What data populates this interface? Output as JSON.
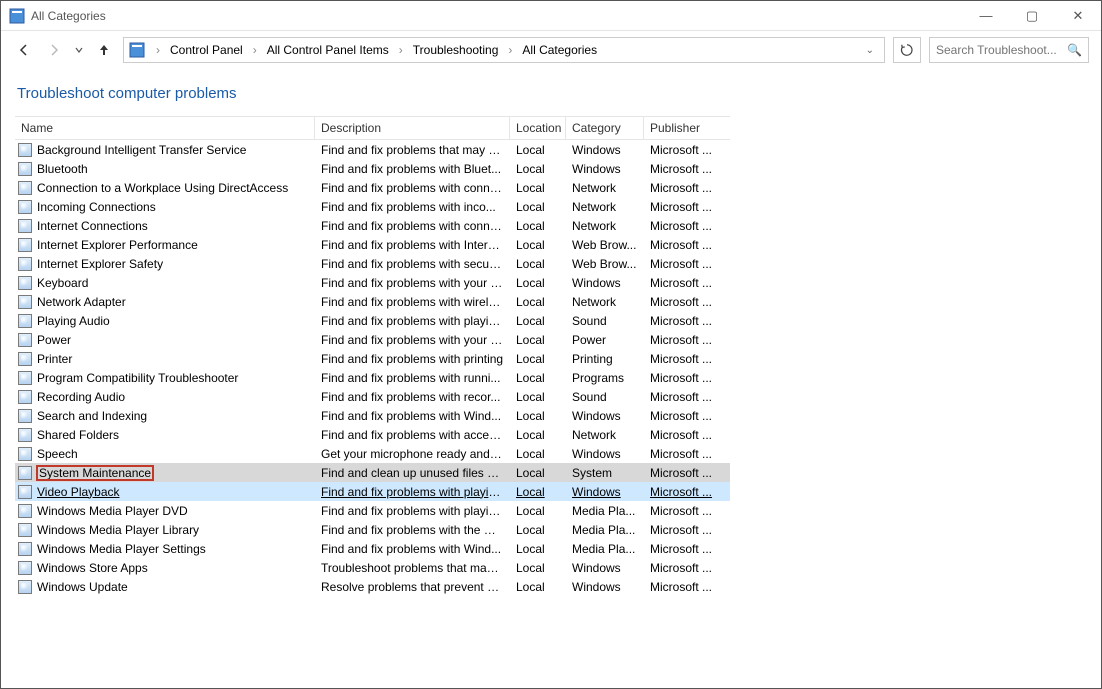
{
  "window": {
    "title": "All Categories"
  },
  "breadcrumb": {
    "items": [
      "Control Panel",
      "All Control Panel Items",
      "Troubleshooting",
      "All Categories"
    ]
  },
  "search": {
    "placeholder": "Search Troubleshoot..."
  },
  "page": {
    "title": "Troubleshoot computer problems"
  },
  "columns": {
    "name": "Name",
    "description": "Description",
    "location": "Location",
    "category": "Category",
    "publisher": "Publisher"
  },
  "rows": [
    {
      "icon": "transfer-icon",
      "name": "Background Intelligent Transfer Service",
      "desc": "Find and fix problems that may p...",
      "loc": "Local",
      "cat": "Windows",
      "pub": "Microsoft ..."
    },
    {
      "icon": "bluetooth-icon",
      "name": "Bluetooth",
      "desc": "Find and fix problems with Bluet...",
      "loc": "Local",
      "cat": "Windows",
      "pub": "Microsoft ..."
    },
    {
      "icon": "connection-icon",
      "name": "Connection to a Workplace Using DirectAccess",
      "desc": "Find and fix problems with conne...",
      "loc": "Local",
      "cat": "Network",
      "pub": "Microsoft ..."
    },
    {
      "icon": "incoming-icon",
      "name": "Incoming Connections",
      "desc": "Find and fix problems with inco...",
      "loc": "Local",
      "cat": "Network",
      "pub": "Microsoft ..."
    },
    {
      "icon": "internet-icon",
      "name": "Internet Connections",
      "desc": "Find and fix problems with conne...",
      "loc": "Local",
      "cat": "Network",
      "pub": "Microsoft ..."
    },
    {
      "icon": "ie-perf-icon",
      "name": "Internet Explorer Performance",
      "desc": "Find and fix problems with Intern...",
      "loc": "Local",
      "cat": "Web Brow...",
      "pub": "Microsoft ..."
    },
    {
      "icon": "ie-safety-icon",
      "name": "Internet Explorer Safety",
      "desc": "Find and fix problems with securi...",
      "loc": "Local",
      "cat": "Web Brow...",
      "pub": "Microsoft ..."
    },
    {
      "icon": "keyboard-icon",
      "name": "Keyboard",
      "desc": "Find and fix problems with your c...",
      "loc": "Local",
      "cat": "Windows",
      "pub": "Microsoft ..."
    },
    {
      "icon": "adapter-icon",
      "name": "Network Adapter",
      "desc": "Find and fix problems with wirele...",
      "loc": "Local",
      "cat": "Network",
      "pub": "Microsoft ..."
    },
    {
      "icon": "audio-play-icon",
      "name": "Playing Audio",
      "desc": "Find and fix problems with playin...",
      "loc": "Local",
      "cat": "Sound",
      "pub": "Microsoft ..."
    },
    {
      "icon": "power-icon",
      "name": "Power",
      "desc": "Find and fix problems with your c...",
      "loc": "Local",
      "cat": "Power",
      "pub": "Microsoft ..."
    },
    {
      "icon": "printer-icon",
      "name": "Printer",
      "desc": "Find and fix problems with printing",
      "loc": "Local",
      "cat": "Printing",
      "pub": "Microsoft ..."
    },
    {
      "icon": "compat-icon",
      "name": "Program Compatibility Troubleshooter",
      "desc": "Find and fix problems with runni...",
      "loc": "Local",
      "cat": "Programs",
      "pub": "Microsoft ..."
    },
    {
      "icon": "audio-rec-icon",
      "name": "Recording Audio",
      "desc": "Find and fix problems with recor...",
      "loc": "Local",
      "cat": "Sound",
      "pub": "Microsoft ..."
    },
    {
      "icon": "search-index-icon",
      "name": "Search and Indexing",
      "desc": "Find and fix problems with Wind...",
      "loc": "Local",
      "cat": "Windows",
      "pub": "Microsoft ..."
    },
    {
      "icon": "shared-folders-icon",
      "name": "Shared Folders",
      "desc": "Find and fix problems with acces...",
      "loc": "Local",
      "cat": "Network",
      "pub": "Microsoft ..."
    },
    {
      "icon": "speech-icon",
      "name": "Speech",
      "desc": "Get your microphone ready and f...",
      "loc": "Local",
      "cat": "Windows",
      "pub": "Microsoft ..."
    },
    {
      "icon": "system-maint-icon",
      "name": "System Maintenance",
      "desc": "Find and clean up unused files an...",
      "loc": "Local",
      "cat": "System",
      "pub": "Microsoft ...",
      "selected": true
    },
    {
      "icon": "video-playback-icon",
      "name": "Video Playback",
      "desc": "Find and fix problems with playin...",
      "loc": "Local",
      "cat": "Windows",
      "pub": "Microsoft ...",
      "hover": true
    },
    {
      "icon": "wmp-dvd-icon",
      "name": "Windows Media Player DVD",
      "desc": "Find and fix problems with playin...",
      "loc": "Local",
      "cat": "Media Pla...",
      "pub": "Microsoft ..."
    },
    {
      "icon": "wmp-lib-icon",
      "name": "Windows Media Player Library",
      "desc": "Find and fix problems with the W...",
      "loc": "Local",
      "cat": "Media Pla...",
      "pub": "Microsoft ..."
    },
    {
      "icon": "wmp-set-icon",
      "name": "Windows Media Player Settings",
      "desc": "Find and fix problems with Wind...",
      "loc": "Local",
      "cat": "Media Pla...",
      "pub": "Microsoft ..."
    },
    {
      "icon": "store-apps-icon",
      "name": "Windows Store Apps",
      "desc": "Troubleshoot problems that may ...",
      "loc": "Local",
      "cat": "Windows",
      "pub": "Microsoft ..."
    },
    {
      "icon": "win-update-icon",
      "name": "Windows Update",
      "desc": "Resolve problems that prevent yo...",
      "loc": "Local",
      "cat": "Windows",
      "pub": "Microsoft ..."
    }
  ]
}
